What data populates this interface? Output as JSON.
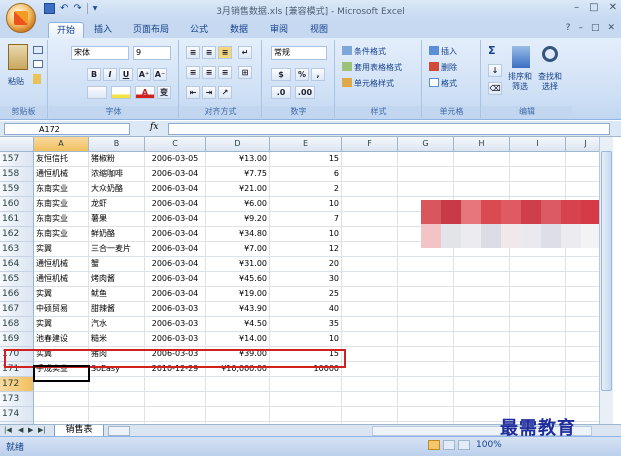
{
  "window": {
    "title": "3月销售数据.xls  [兼容模式] - Microsoft Excel",
    "min": "–",
    "max": "□",
    "close": "✕"
  },
  "qat": {
    "undo": "↶",
    "redo": "↷",
    "more": "▼"
  },
  "tabs": [
    "开始",
    "插入",
    "页面布局",
    "公式",
    "数据",
    "审阅",
    "视图"
  ],
  "help": {
    "help": "?",
    "min": "–",
    "restore": "□",
    "close": "✕"
  },
  "ribbon": {
    "paste": "粘贴",
    "font_name": "宋体",
    "font_size": "9",
    "bold": "B",
    "italic": "I",
    "underline": "U",
    "grow": "A⁺",
    "shrink": "A⁻",
    "wen": "变",
    "number_format": "常规",
    "percent": "%",
    "comma": ",",
    "cond_format": "条件格式",
    "table_format": "套用表格格式",
    "cell_style": "单元格样式",
    "insert": "插入",
    "delete": "删除",
    "format": "格式",
    "sigma": "Σ",
    "sort": "排序和\n筛选",
    "find": "查找和\n选择",
    "groups": {
      "clipboard": "剪贴板",
      "font": "字体",
      "align": "对齐方式",
      "number": "数字",
      "styles": "样式",
      "cells": "单元格",
      "editing": "编辑"
    }
  },
  "formula": {
    "name_box": "A172",
    "fx": "fx",
    "content": ""
  },
  "columns": [
    "A",
    "B",
    "C",
    "D",
    "E",
    "F",
    "G",
    "H",
    "I",
    "J"
  ],
  "rows": [
    {
      "n": "157",
      "a": "友恒信托",
      "b": "猪椒粉",
      "c": "2006-03-05",
      "d": "¥13.00",
      "e": "15"
    },
    {
      "n": "158",
      "a": "通恒机械",
      "b": "浓缩咖啡",
      "c": "2006-03-04",
      "d": "¥7.75",
      "e": "6"
    },
    {
      "n": "159",
      "a": "东南实业",
      "b": "大众奶酪",
      "c": "2006-03-04",
      "d": "¥21.00",
      "e": "2"
    },
    {
      "n": "160",
      "a": "东南实业",
      "b": "龙虾",
      "c": "2006-03-04",
      "d": "¥6.00",
      "e": "10"
    },
    {
      "n": "161",
      "a": "东南实业",
      "b": "薯果",
      "c": "2006-03-04",
      "d": "¥9.20",
      "e": "7"
    },
    {
      "n": "162",
      "a": "东南实业",
      "b": "鲜奶酪",
      "c": "2006-03-04",
      "d": "¥34.80",
      "e": "10"
    },
    {
      "n": "163",
      "a": "实翼",
      "b": "三合一麦片",
      "c": "2006-03-04",
      "d": "¥7.00",
      "e": "12"
    },
    {
      "n": "164",
      "a": "通恒机械",
      "b": "蟹",
      "c": "2006-03-04",
      "d": "¥31.00",
      "e": "20"
    },
    {
      "n": "165",
      "a": "通恒机械",
      "b": "烤肉酱",
      "c": "2006-03-04",
      "d": "¥45.60",
      "e": "30"
    },
    {
      "n": "166",
      "a": "实翼",
      "b": "鱿鱼",
      "c": "2006-03-04",
      "d": "¥19.00",
      "e": "25"
    },
    {
      "n": "167",
      "a": "中硕贸易",
      "b": "甜辣酱",
      "c": "2006-03-03",
      "d": "¥43.90",
      "e": "40"
    },
    {
      "n": "168",
      "a": "实翼",
      "b": "汽水",
      "c": "2006-03-03",
      "d": "¥4.50",
      "e": "35"
    },
    {
      "n": "169",
      "a": "池春建设",
      "b": "糙米",
      "c": "2006-03-03",
      "d": "¥14.00",
      "e": "10"
    },
    {
      "n": "170",
      "a": "实翼",
      "b": "猪肉",
      "c": "2006-03-03",
      "d": "¥39.00",
      "e": "15"
    },
    {
      "n": "171",
      "a": "手成实业",
      "b": "SoEasy",
      "c": "2010-12-29",
      "d": "¥10,000.00",
      "e": "10000"
    },
    {
      "n": "172",
      "a": "",
      "b": "",
      "c": "",
      "d": "",
      "e": ""
    },
    {
      "n": "173",
      "a": "",
      "b": "",
      "c": "",
      "d": "",
      "e": ""
    },
    {
      "n": "174",
      "a": "",
      "b": "",
      "c": "",
      "d": "",
      "e": ""
    },
    {
      "n": "175",
      "a": "",
      "b": "",
      "c": "",
      "d": "",
      "e": ""
    }
  ],
  "sheet": {
    "tab": "销售表",
    "nav_first": "|◀",
    "nav_prev": "◀",
    "nav_next": "▶",
    "nav_last": "▶|"
  },
  "status": {
    "ready": "就绪",
    "zoom": "100%"
  },
  "watermark": "最需教育",
  "mosaic_colors": [
    "#d9565f",
    "#c93a48",
    "#e6757c",
    "#d94a52",
    "#e05a63",
    "#cf3f4b",
    "#db5a63",
    "#d6424d",
    "#d63a44",
    "#f2c4c6",
    "#e3e3ea",
    "#ececf0",
    "#dcdce6",
    "#f0e8ea",
    "#e9e9ef",
    "#dedee8",
    "#ececf0",
    "#f3f3f6"
  ]
}
